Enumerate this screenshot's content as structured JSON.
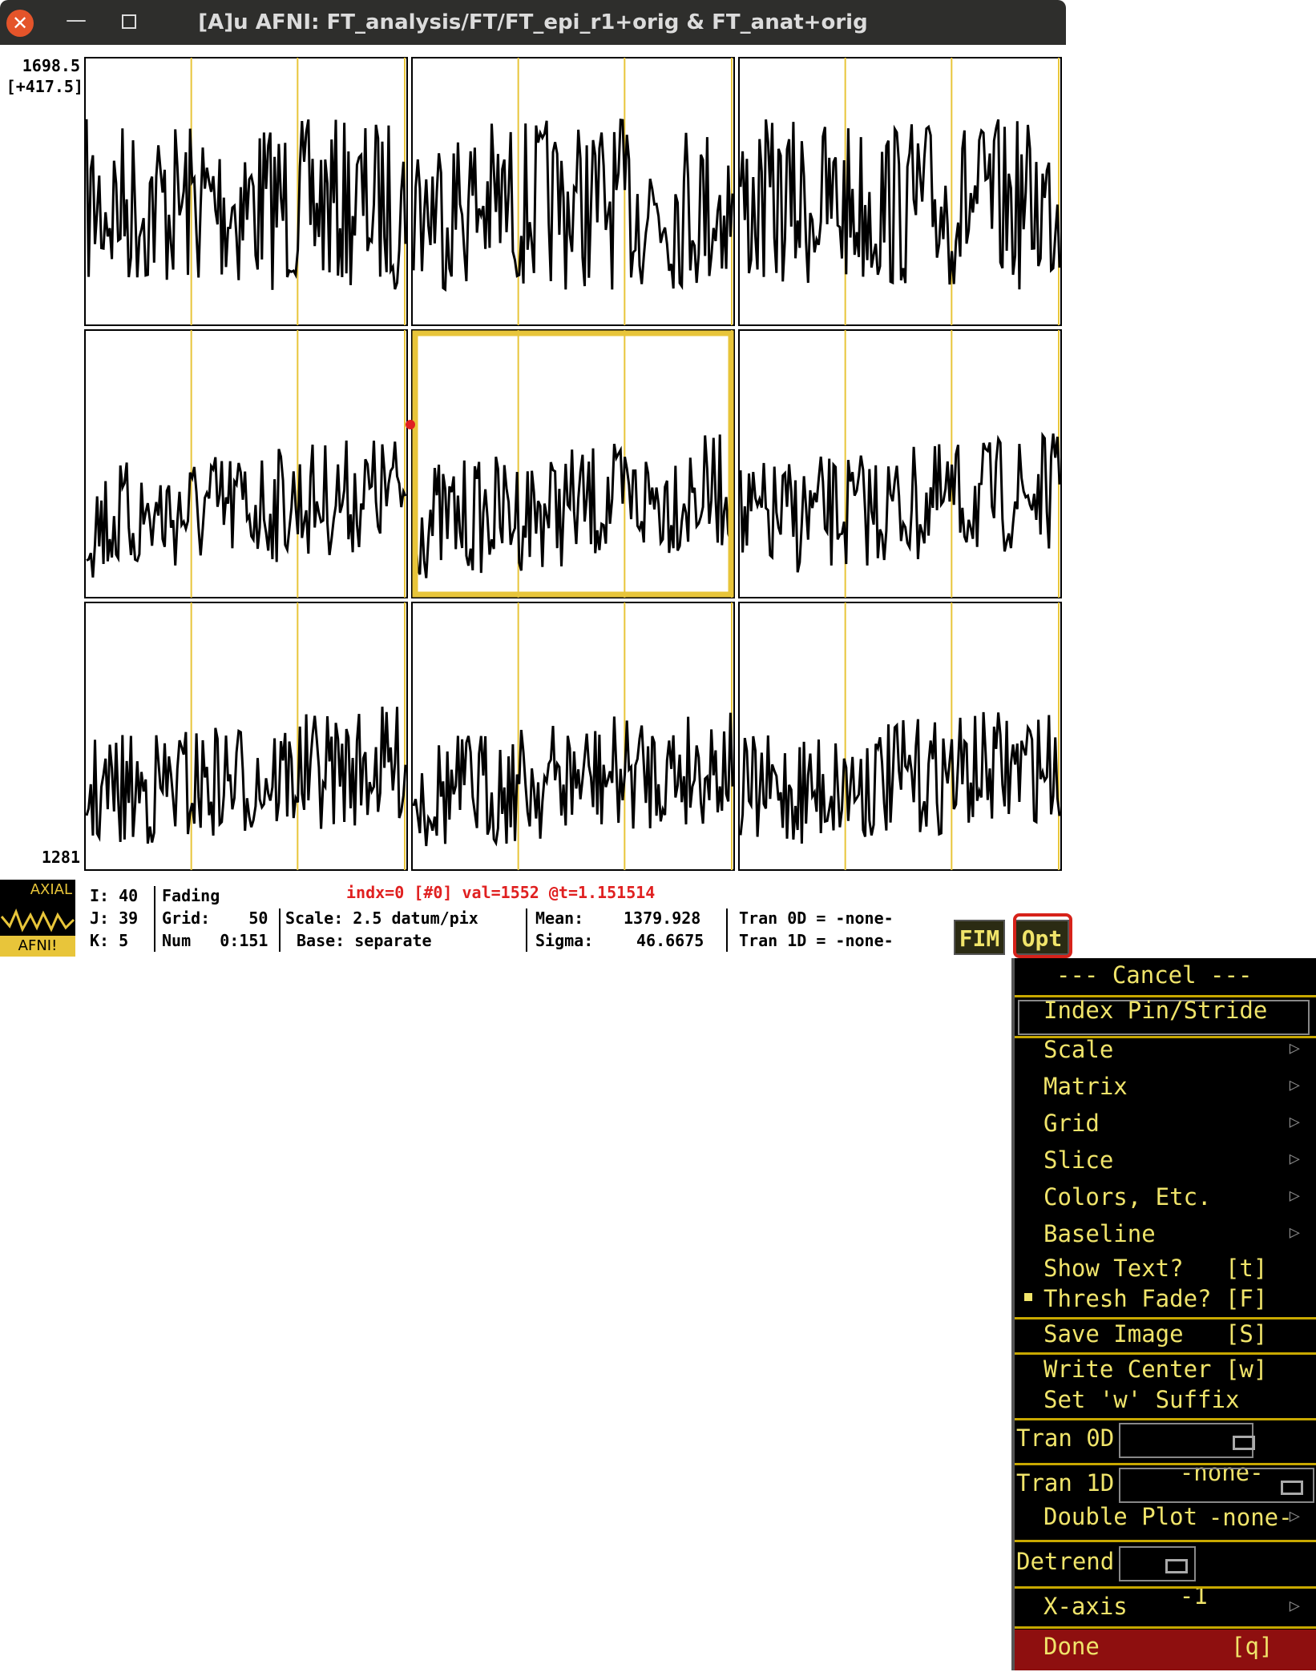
{
  "window": {
    "title": "[A]u AFNI: FT_analysis/FT/FT_epi_r1+orig & FT_anat+orig",
    "close_symbol": "✕",
    "minimize_symbol": "—"
  },
  "graph": {
    "y_top": "1698.5",
    "y_range": "[+417.5]",
    "y_bottom": "1281",
    "grid_cols": 3,
    "grid_rows": 3,
    "selected_cell": 4,
    "trace_color": "#000000",
    "grid_line_color": "#e8c53a",
    "selected_border_color": "#e8c53a"
  },
  "logo": {
    "top_text": "AXIAL",
    "bottom_text": "AFNI!"
  },
  "info": {
    "i": "I: 40",
    "j": "J: 39",
    "k": "K: 5",
    "fading": "Fading",
    "grid": "Grid:    50",
    "num": "Num   0:151",
    "index_line": "indx=0 [#0] val=1552 @t=1.151514",
    "scale": "Scale: 2.5 datum/pix",
    "base": "Base: separate",
    "mean_label": "Mean:",
    "mean_value": "1379.928",
    "sigma_label": "Sigma:",
    "sigma_value": "46.6675",
    "tran0d": "Tran 0D = -none-",
    "tran1d": "Tran 1D = -none-"
  },
  "buttons": {
    "fim": "FIM",
    "opt": "Opt"
  },
  "menu": {
    "cancel": "--- Cancel ---",
    "index_pin": "Index Pin/Stride",
    "scale": "Scale",
    "matrix": "Matrix",
    "grid": "Grid",
    "slice": "Slice",
    "colors": "Colors, Etc.",
    "baseline": "Baseline",
    "show_text": "Show Text?   [t]",
    "thresh_fade": "Thresh Fade? [F]",
    "save_image": "Save Image   [S]",
    "write_center": "Write Center [w]",
    "set_suffix": "Set 'w' Suffix",
    "tran0d_label": "Tran 0D",
    "tran0d_value": "-none-",
    "tran1d_label": "Tran 1D",
    "tran1d_value": "-none-",
    "double_plot": "Double Plot",
    "detrend_label": "Detrend",
    "detrend_value": "-1",
    "xaxis": "X-axis",
    "done": "Done",
    "done_key": "[q]",
    "submenu_arrow": "▷"
  }
}
